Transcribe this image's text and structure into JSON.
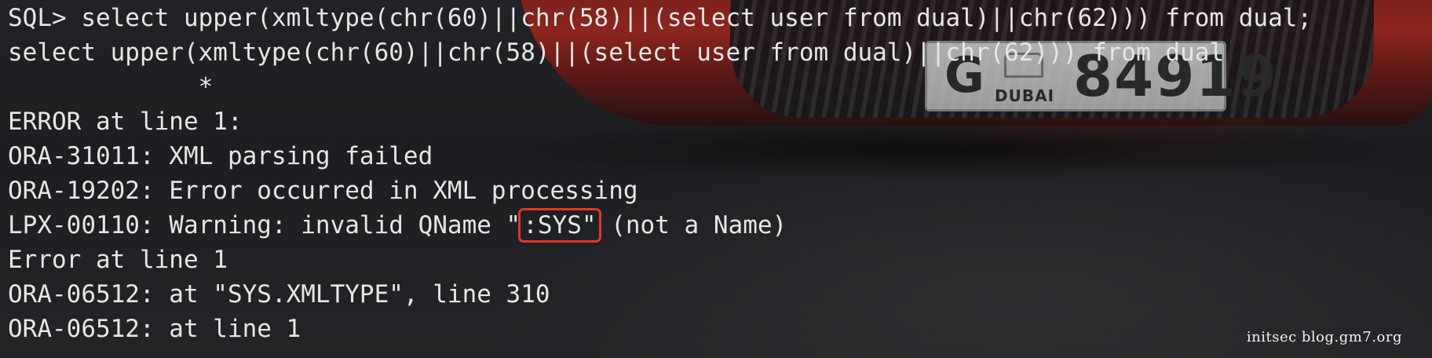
{
  "terminal": {
    "lines": [
      "SQL> select upper(xmltype(chr(60)||chr(58)||(select user from dual)||chr(62))) from dual;",
      "select upper(xmltype(chr(60)||chr(58)||(select user from dual)||chr(62))) from dual",
      "             *",
      "ERROR at line 1:",
      "ORA-31011: XML parsing failed",
      "ORA-19202: Error occurred in XML processing"
    ],
    "warning_line": {
      "prefix": "LPX-00110: Warning: invalid QName \"",
      "highlighted": ":SYS\"",
      "suffix": " (not a Name)"
    },
    "lines_after": [
      "Error at line 1",
      "ORA-06512: at \"SYS.XMLTYPE\", line 310",
      "ORA-06512: at line 1"
    ]
  },
  "background": {
    "plate_letter": "G",
    "plate_city": "DUBAI",
    "plate_number": "84919"
  },
  "watermark": "initsec blog.gm7.org",
  "colors": {
    "text": "#e6e6e6",
    "highlight_box": "#e2362b",
    "background": "#1c1e21"
  }
}
